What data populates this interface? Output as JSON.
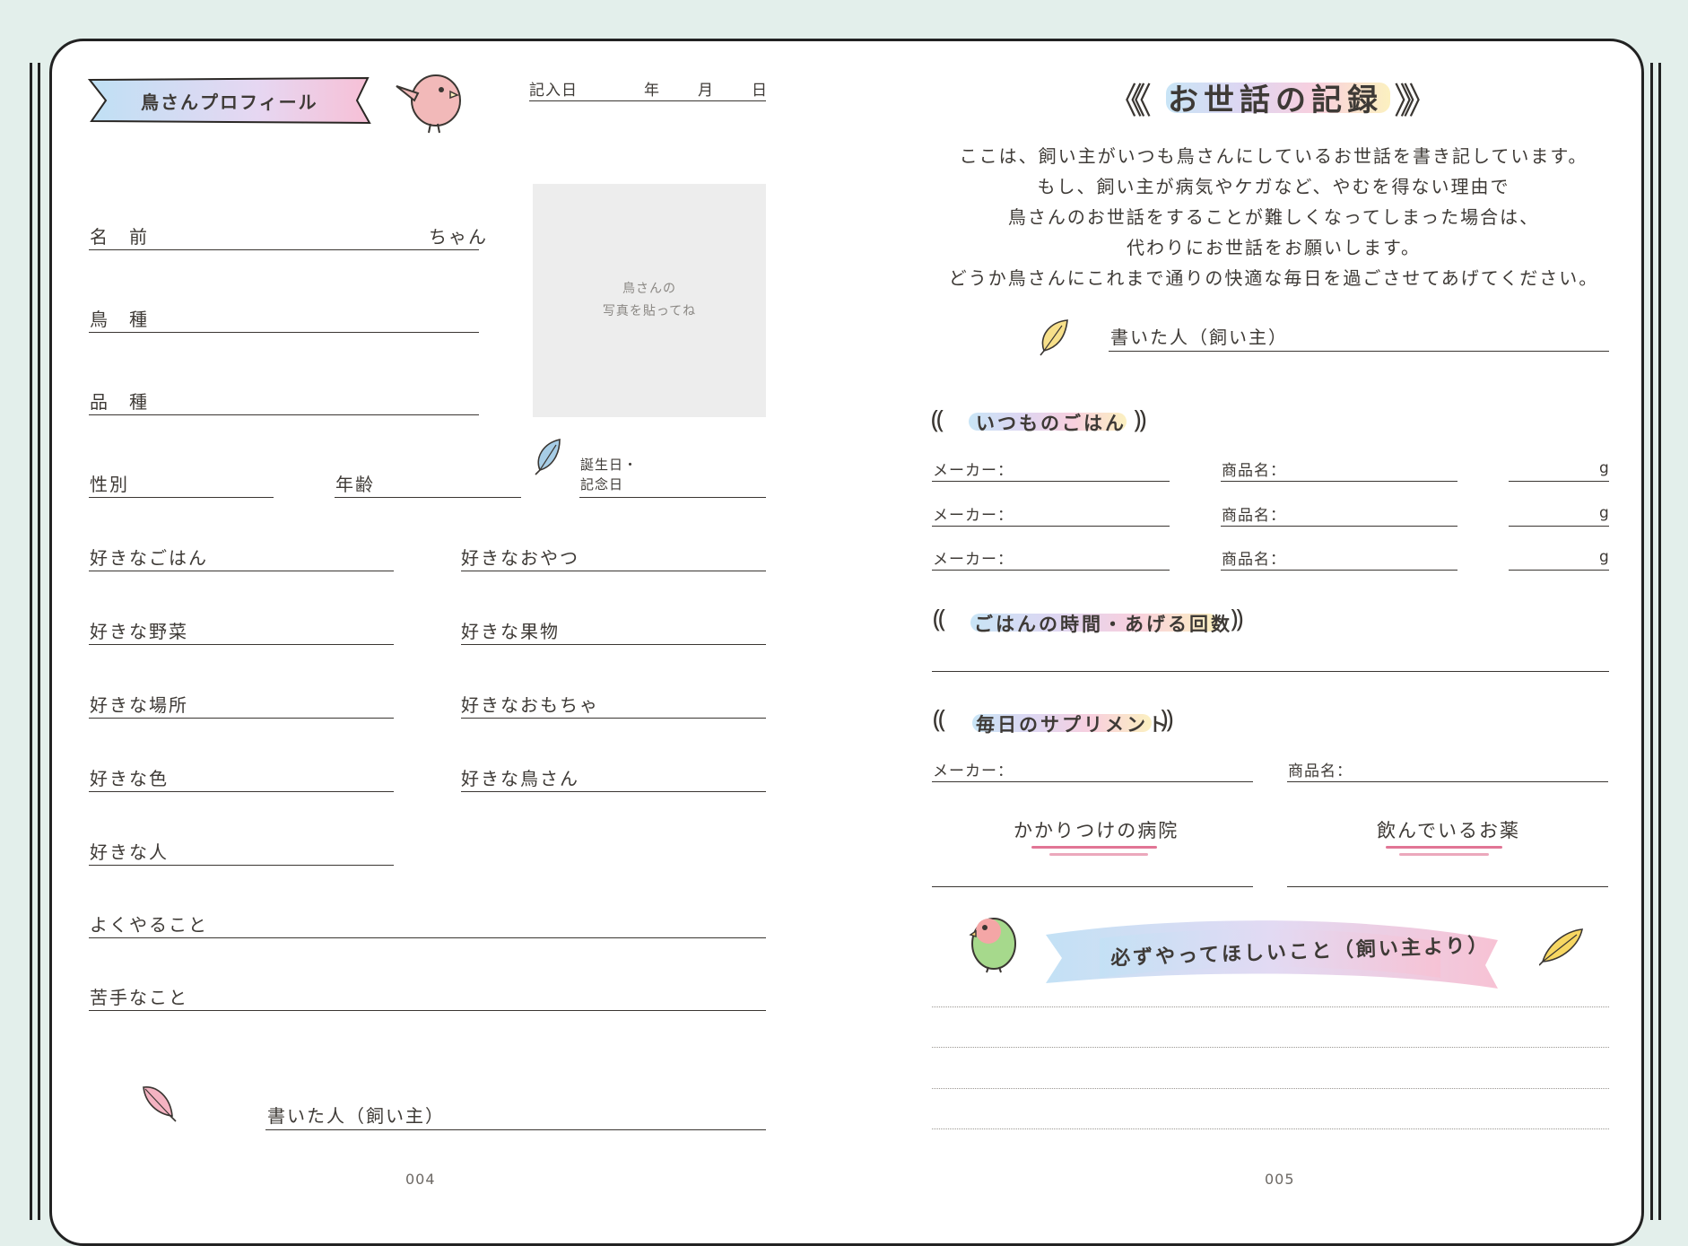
{
  "left": {
    "banner_title": "鳥さんプロフィール",
    "entry_date": {
      "label": "記入日",
      "year": "年",
      "month": "月",
      "day": "日"
    },
    "photo_hint": [
      "鳥さんの",
      "写真を貼ってね"
    ],
    "name_label": "名　前",
    "name_suffix": "ちゃん",
    "species_label": "鳥　種",
    "breed_label": "品　種",
    "sex_label": "性別",
    "age_label": "年齢",
    "birthday_label": [
      "誕生日・",
      "記念日"
    ],
    "fav_food": "好きなごはん",
    "fav_snack": "好きなおやつ",
    "fav_veg": "好きな野菜",
    "fav_fruit": "好きな果物",
    "fav_place": "好きな場所",
    "fav_toy": "好きなおもちゃ",
    "fav_color": "好きな色",
    "fav_bird": "好きな鳥さん",
    "fav_person": "好きな人",
    "habit": "よくやること",
    "dislike": "苦手なこと",
    "writer": "書いた人（飼い主）",
    "page_number": "004"
  },
  "right": {
    "title": "お世話の記録",
    "intro": [
      "ここは、飼い主がいつも鳥さんにしているお世話を書き記しています。",
      "もし、飼い主が病気やケガなど、やむを得ない理由で",
      "鳥さんのお世話をすることが難しくなってしまった場合は、",
      "代わりにお世話をお願いします。",
      "どうか鳥さんにこれまで通りの快適な毎日を過ごさせてあげてください。"
    ],
    "writer": "書いた人（飼い主）",
    "food_heading": "いつものごはん",
    "maker_label": "メーカー：",
    "product_label": "商品名：",
    "gram": "g",
    "meal_time_heading": "ごはんの時間・あげる回数",
    "supplement_heading": "毎日のサプリメント",
    "hospital": "かかりつけの病院",
    "medicine": "飲んでいるお薬",
    "must_do": "必ずやってほしいこと（飼い主より）",
    "page_number": "005"
  },
  "colors": {
    "ink": "#3e3a36",
    "banner_gradient": [
      "#bfe0f4",
      "#f7c7d8"
    ],
    "photo_box": "#ededed",
    "background": "#e3efeb"
  },
  "icons": [
    "bird-illustration",
    "feather-icon",
    "lovebird-illustration",
    "chevron-left-icon",
    "chevron-right-icon"
  ]
}
